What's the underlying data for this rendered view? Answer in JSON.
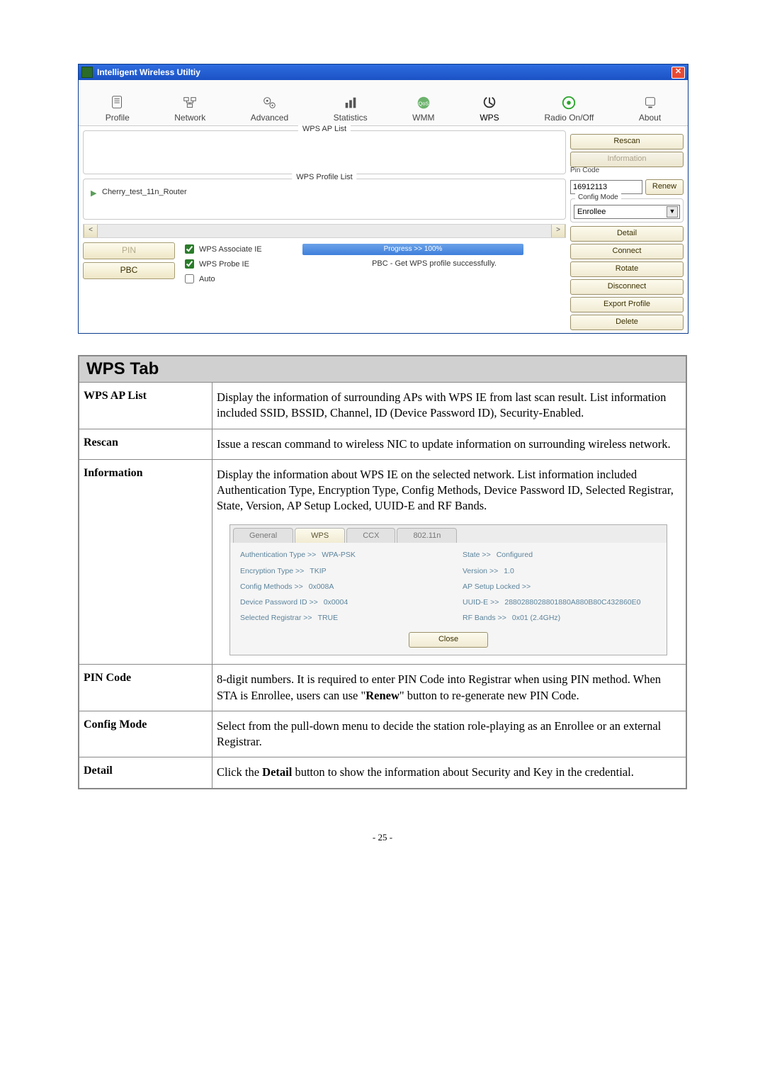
{
  "window": {
    "title": "Intelligent Wireless Utiltiy"
  },
  "tabs": {
    "profile": "Profile",
    "network": "Network",
    "advanced": "Advanced",
    "statistics": "Statistics",
    "wmm": "WMM",
    "wps": "WPS",
    "radio": "Radio On/Off",
    "about": "About"
  },
  "groups": {
    "ap_list": "WPS AP List",
    "profile_list": "WPS Profile List"
  },
  "side": {
    "rescan": "Rescan",
    "information": "Information",
    "pin_code_label": "Pin Code",
    "pin_code_value": "16912113",
    "renew": "Renew",
    "config_mode_label": "Config Mode",
    "config_mode_value": "Enrollee",
    "detail": "Detail",
    "connect": "Connect",
    "rotate": "Rotate",
    "disconnect": "Disconnect",
    "export": "Export Profile",
    "delete": "Delete"
  },
  "profile_entry": "Cherry_test_11n_Router",
  "pin_btn": "PIN",
  "pbc_btn": "PBC",
  "checks": {
    "assoc": "WPS Associate IE",
    "probe": "WPS Probe IE",
    "auto": "Auto"
  },
  "progress_text": "Progress >> 100%",
  "status_text": "PBC - Get WPS profile successfully.",
  "table": {
    "heading": "WPS Tab",
    "rows": {
      "wps_ap_list": {
        "label": "WPS AP List",
        "desc": "Display the information of surrounding APs with WPS IE from last scan result. List information included SSID, BSSID, Channel, ID (Device Password ID), Security-Enabled."
      },
      "rescan": {
        "label": "Rescan",
        "desc": "Issue a rescan command to wireless NIC to update information on surrounding wireless network."
      },
      "information": {
        "label": "Information",
        "desc": "Display the information about WPS IE on the selected network. List information included Authentication Type, Encryption Type, Config Methods, Device Password ID, Selected Registrar, State, Version, AP Setup Locked, UUID-E and RF Bands."
      },
      "pin_code": {
        "label": "PIN Code",
        "desc_before": "8-digit numbers. It is required to enter PIN Code into Registrar when using PIN method. When STA is Enrollee, users can use \"",
        "desc_bold": "Renew",
        "desc_after": "\" button to re-generate new PIN Code."
      },
      "config_mode": {
        "label": "Config Mode",
        "desc": "Select from the pull-down menu to decide the station role-playing as an Enrollee or an external Registrar."
      },
      "detail": {
        "label": "Detail",
        "desc_before": "Click the ",
        "desc_bold": "Detail",
        "desc_after": " button to show the information about Security and Key in the credential."
      }
    }
  },
  "subdialog": {
    "tabs": {
      "general": "General",
      "wps": "WPS",
      "ccx": "CCX",
      "80211n": "802.11n"
    },
    "auth_type_k": "Authentication Type >>",
    "auth_type_v": "WPA-PSK",
    "enc_type_k": "Encryption Type >>",
    "enc_type_v": "TKIP",
    "config_methods_k": "Config Methods >>",
    "config_methods_v": "0x008A",
    "dev_pw_k": "Device Password ID >>",
    "dev_pw_v": "0x0004",
    "sel_reg_k": "Selected Registrar >>",
    "sel_reg_v": "TRUE",
    "state_k": "State >>",
    "state_v": "Configured",
    "version_k": "Version >>",
    "version_v": "1.0",
    "apsetup_k": "AP Setup Locked >>",
    "apsetup_v": "",
    "uuid_k": "UUID-E >>",
    "uuid_v": "2880288028801880A880B80C432860E0",
    "rfbands_k": "RF Bands >>",
    "rfbands_v": "0x01 (2.4GHz)",
    "close": "Close"
  },
  "page_number": "- 25 -"
}
